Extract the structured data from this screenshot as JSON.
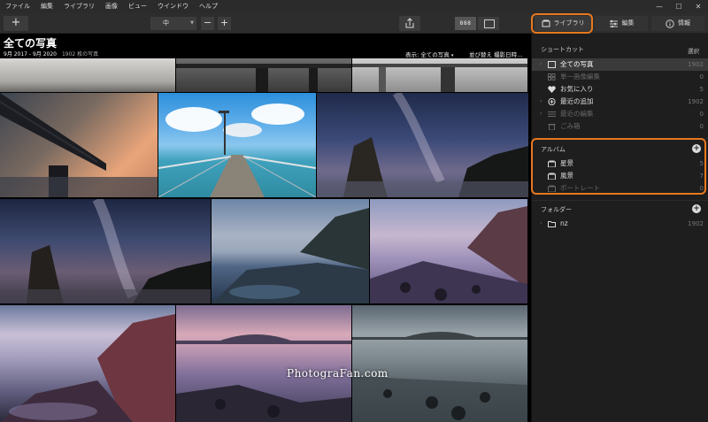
{
  "menu": [
    "ファイル",
    "編集",
    "ライブラリ",
    "画像",
    "ビュー",
    "ウインドウ",
    "ヘルプ"
  ],
  "window_controls": {
    "minimize": "—",
    "maximize": "☐",
    "close": "✕"
  },
  "toolbar": {
    "add": "+",
    "thumb_size": "中",
    "minus": "−",
    "plus": "+",
    "grid_view": "888"
  },
  "tabs": {
    "library": "ライブラリ",
    "edit": "編集",
    "info": "情報"
  },
  "gallery": {
    "title": "全ての写真",
    "date_range": "9月 2017 - 9月 2020",
    "count": "1902 枚の写真",
    "display_label": "表示:",
    "display_value": "全ての写真",
    "sort_label": "並び替え",
    "sort_value": "撮影日時"
  },
  "sidebar": {
    "shortcuts_heading": "ショートカット",
    "select_label": "選択",
    "shortcuts": [
      {
        "label": "全ての写真",
        "count": "1902",
        "icon": "photos-icon",
        "state": "active"
      },
      {
        "label": "単一画像編集",
        "count": "0",
        "icon": "grid-icon",
        "state": "dim"
      },
      {
        "label": "お気に入り",
        "count": "5",
        "icon": "heart-icon",
        "state": "normal"
      },
      {
        "label": "最近の追加",
        "count": "1902",
        "icon": "plus-circle-icon",
        "state": "normal"
      },
      {
        "label": "最近の編集",
        "count": "0",
        "icon": "sliders-icon",
        "state": "dim"
      },
      {
        "label": "ごみ箱",
        "count": "0",
        "icon": "trash-icon",
        "state": "dim"
      }
    ],
    "albums_heading": "アルバム",
    "albums": [
      {
        "label": "星景",
        "count": "5",
        "state": "normal"
      },
      {
        "label": "風景",
        "count": "7",
        "state": "normal"
      },
      {
        "label": "ポートレート",
        "count": "0",
        "state": "dim"
      }
    ],
    "folders_heading": "フォルダー",
    "folders": [
      {
        "label": "nz",
        "count": "1902"
      }
    ]
  },
  "watermark": "PhotograFan.com",
  "colors": {
    "highlight": "#e8781e",
    "panel": "#1e1e1e",
    "toolbar": "#2d2d2d"
  }
}
